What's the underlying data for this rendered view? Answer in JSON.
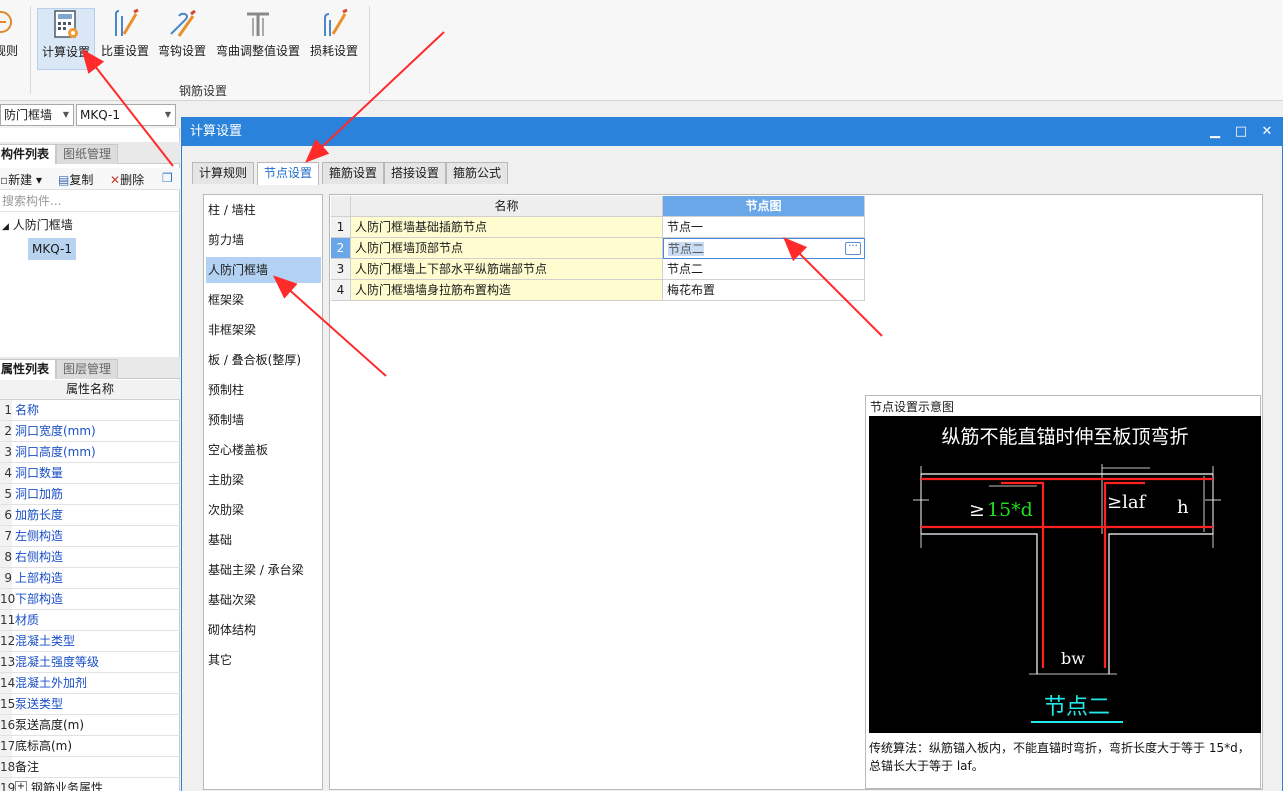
{
  "ribbon": {
    "left_partial_label": "规则",
    "buttons": [
      {
        "label": "计算设置",
        "icon": "calculator-settings-icon"
      },
      {
        "label": "比重设置",
        "icon": "rebar-density-icon"
      },
      {
        "label": "弯钩设置",
        "icon": "hook-settings-icon"
      },
      {
        "label": "弯曲调整值设置",
        "icon": "bend-adjust-icon"
      },
      {
        "label": "损耗设置",
        "icon": "loss-settings-icon"
      }
    ],
    "group_label": "钢筋设置"
  },
  "selectors": {
    "type_value": "防门框墙",
    "item_value": "MKQ-1"
  },
  "component_panel": {
    "tabs": [
      "构件列表",
      "图纸管理"
    ],
    "toolbar": {
      "new": "新建",
      "copy": "复制",
      "delete": "删除"
    },
    "search_placeholder": "搜索构件...",
    "tree_root": "人防门框墙",
    "tree_child": "MKQ-1"
  },
  "property_panel": {
    "tabs": [
      "属性列表",
      "图层管理"
    ],
    "header": "属性名称",
    "rows": [
      {
        "n": "1",
        "name": "名称",
        "blue": true
      },
      {
        "n": "2",
        "name": "洞口宽度(mm)",
        "blue": true
      },
      {
        "n": "3",
        "name": "洞口高度(mm)",
        "blue": true
      },
      {
        "n": "4",
        "name": "洞口数量",
        "blue": true
      },
      {
        "n": "5",
        "name": "洞口加筋",
        "blue": true
      },
      {
        "n": "6",
        "name": "加筋长度",
        "blue": true
      },
      {
        "n": "7",
        "name": "左侧构造",
        "blue": true
      },
      {
        "n": "8",
        "name": "右侧构造",
        "blue": true
      },
      {
        "n": "9",
        "name": "上部构造",
        "blue": true
      },
      {
        "n": "10",
        "name": "下部构造",
        "blue": true
      },
      {
        "n": "11",
        "name": "材质",
        "blue": true
      },
      {
        "n": "12",
        "name": "混凝土类型",
        "blue": true
      },
      {
        "n": "13",
        "name": "混凝土强度等级",
        "blue": true
      },
      {
        "n": "14",
        "name": "混凝土外加剂",
        "blue": true
      },
      {
        "n": "15",
        "name": "泵送类型",
        "blue": true
      },
      {
        "n": "16",
        "name": "泵送高度(m)",
        "blue": false
      },
      {
        "n": "17",
        "name": "底标高(m)",
        "blue": false
      },
      {
        "n": "18",
        "name": "备注",
        "blue": false
      },
      {
        "n": "19",
        "name": "钢筋业务属性",
        "blue": false
      }
    ]
  },
  "dialog": {
    "title": "计算设置",
    "tabs": [
      "计算规则",
      "节点设置",
      "箍筋设置",
      "搭接设置",
      "箍筋公式"
    ],
    "active_tab": "节点设置",
    "categories": [
      "柱 / 墙柱",
      "剪力墙",
      "人防门框墙",
      "框架梁",
      "非框架梁",
      "板 / 叠合板(整厚)",
      "预制柱",
      "预制墙",
      "空心楼盖板",
      "主肋梁",
      "次肋梁",
      "基础",
      "基础主梁 / 承台梁",
      "基础次梁",
      "砌体结构",
      "其它"
    ],
    "selected_category": "人防门框墙",
    "grid": {
      "col_name": "名称",
      "col_node": "节点图",
      "rows": [
        {
          "n": "1",
          "name": "人防门框墙基础插筋节点",
          "node": "节点一"
        },
        {
          "n": "2",
          "name": "人防门框墙顶部节点",
          "node": "节点二"
        },
        {
          "n": "3",
          "name": "人防门框墙上下部水平纵筋端部节点",
          "node": "节点二"
        },
        {
          "n": "4",
          "name": "人防门框墙墙身拉筋布置构造",
          "node": "梅花布置"
        }
      ],
      "selected_row": 2,
      "ellipsis": "···"
    },
    "diagram": {
      "title": "节点设置示意图",
      "heading": "纵筋不能直锚时伸至板顶弯折",
      "label_15d": "≥15*d",
      "label_laf": "≥laf",
      "label_h": "h",
      "label_bw": "bw",
      "caption": "节点二",
      "description": "传统算法：纵筋锚入板内，不能直锚时弯折，弯折长度大于等于 15*d，总锚长大于等于 laf。"
    }
  }
}
